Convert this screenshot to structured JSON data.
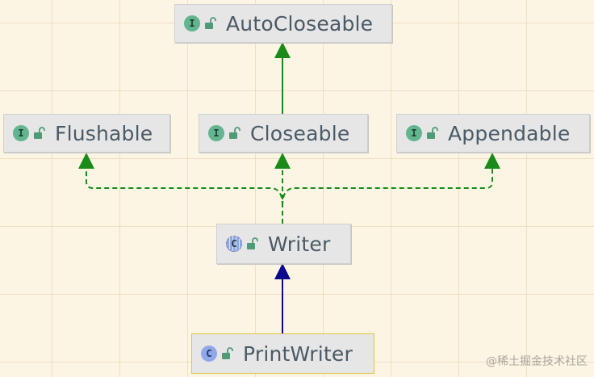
{
  "nodes": [
    {
      "id": "autocloseable",
      "kind": "I",
      "kind_type": "interface",
      "label": "AutoCloseable"
    },
    {
      "id": "flushable",
      "kind": "I",
      "kind_type": "interface",
      "label": "Flushable"
    },
    {
      "id": "closeable",
      "kind": "I",
      "kind_type": "interface",
      "label": "Closeable"
    },
    {
      "id": "appendable",
      "kind": "I",
      "kind_type": "interface",
      "label": "Appendable"
    },
    {
      "id": "writer",
      "kind": "C",
      "kind_type": "abstract-class",
      "label": "Writer"
    },
    {
      "id": "printwriter",
      "kind": "C",
      "kind_type": "class",
      "label": "PrintWriter"
    }
  ],
  "edges": [
    {
      "from": "closeable",
      "to": "autocloseable",
      "type": "extends"
    },
    {
      "from": "writer",
      "to": "flushable",
      "type": "implements"
    },
    {
      "from": "writer",
      "to": "closeable",
      "type": "implements"
    },
    {
      "from": "writer",
      "to": "appendable",
      "type": "implements"
    },
    {
      "from": "printwriter",
      "to": "writer",
      "type": "extends"
    }
  ],
  "colors": {
    "interface_badge": "#62b58f",
    "class_badge": "#8fa8ea",
    "implements_edge": "#1a8a1a",
    "extends_interface_edge": "#1a8a1a",
    "extends_class_edge": "#0a0a8a",
    "selected_border": "#e6c344",
    "canvas": "#fdf5e3"
  },
  "icons": {
    "visibility": "unlocked-padlock-icon"
  },
  "watermark": "@稀土掘金技术社区"
}
